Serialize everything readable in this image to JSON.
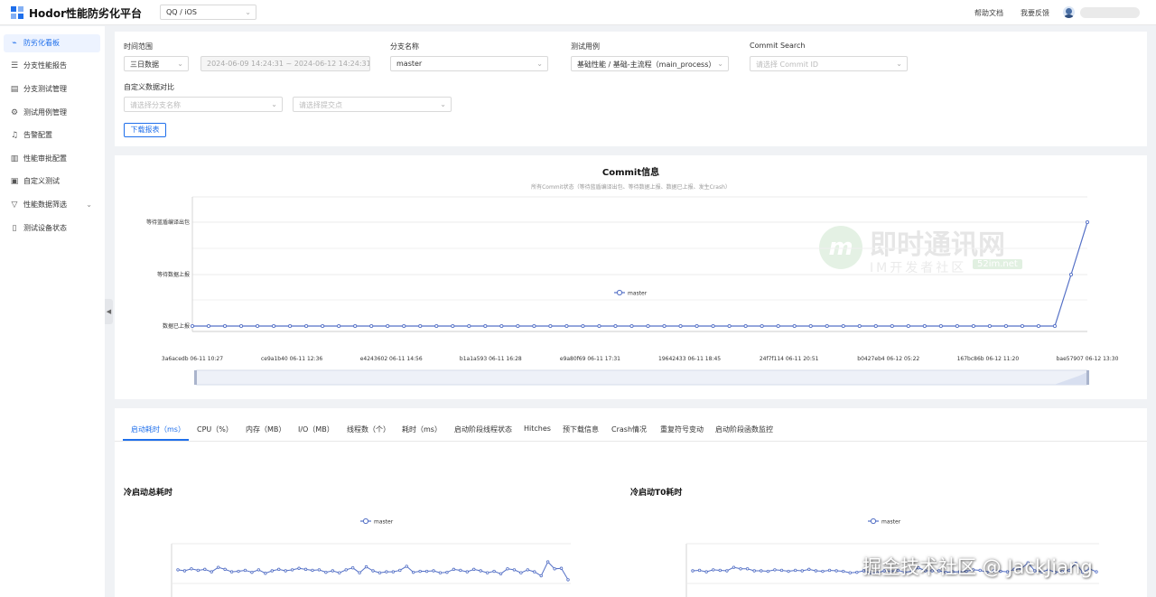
{
  "header": {
    "title": "Hodor性能防劣化平台",
    "app_selector": "QQ / iOS",
    "help_link": "帮助文档",
    "feedback_link": "我要反馈"
  },
  "sidebar": {
    "items": [
      {
        "label": "防劣化看板",
        "icon": "line-chart-icon",
        "glyph": "⌁"
      },
      {
        "label": "分支性能报告",
        "icon": "list-icon",
        "glyph": "☰"
      },
      {
        "label": "分支测试管理",
        "icon": "tasks-icon",
        "glyph": "▤"
      },
      {
        "label": "测试用例管理",
        "icon": "gear-icon",
        "glyph": "⚙"
      },
      {
        "label": "告警配置",
        "icon": "alarm-icon",
        "glyph": "♫"
      },
      {
        "label": "性能审批配置",
        "icon": "approval-icon",
        "glyph": "▥"
      },
      {
        "label": "自定义测试",
        "icon": "terminal-icon",
        "glyph": "▣"
      },
      {
        "label": "性能数据筛选",
        "icon": "filter-icon",
        "glyph": "▽"
      },
      {
        "label": "测试设备状态",
        "icon": "device-icon",
        "glyph": "▯"
      }
    ]
  },
  "filters": {
    "time_range_label": "时间范围",
    "time_range_value": "三日数据",
    "date_range": "2024-06-09 14:24:31 ~ 2024-06-12 14:24:31",
    "branch_label": "分支名称",
    "branch_value": "master",
    "case_label": "测试用例",
    "case_value": "基础性能 / 基础-主流程（main_process）",
    "commit_search_label": "Commit Search",
    "commit_search_placeholder": "请选择 Commit ID",
    "custom_compare_label": "自定义数据对比",
    "custom_branch_placeholder": "请选择分支名称",
    "custom_commit_placeholder": "请选择提交点",
    "download_button": "下载报表"
  },
  "commit_chart": {
    "title": "Commit信息",
    "subtitle": "所有Commit状态（等待蓝盾编译出包、等待数据上报、数据已上报、发生Crash）",
    "legend": "master",
    "watermark_title": "即时通讯网",
    "watermark_sub": "IM开发者社区",
    "watermark_domain": "52im.net"
  },
  "tabs": {
    "items": [
      "启动耗时（ms）",
      "CPU（%）",
      "内存（MB）",
      "I/O（MB）",
      "线程数（个）",
      "耗时（ms）",
      "启动阶段线程状态",
      "Hitches",
      "预下载信息",
      "Crash情况",
      "重复符号变动",
      "启动阶段函数监控"
    ],
    "active": 0
  },
  "small_charts": {
    "left_title": "冷启动总耗时",
    "right_title": "冷启动T0耗时",
    "legend": "master"
  },
  "footer_watermark": "掘金技术社区 @ JackJiang",
  "colors": {
    "accent": "#1f6feb",
    "series": "#5470c6"
  },
  "chart_data": [
    {
      "type": "line",
      "title": "Commit信息",
      "subtitle": "所有Commit状态（等待蓝盾编译出包、等待数据上报、数据已上报、发生Crash）",
      "y_categories": [
        "数据已上报",
        "等待数据上报",
        "等待蓝盾编译出包"
      ],
      "x_tick_labels": [
        "3a6acedb 06-11 10:27",
        "ce9a1b40 06-11 12:36",
        "e4243602 06-11 14:56",
        "b1a1a593 06-11 16:28",
        "e9a80f69 06-11 17:31",
        "19642433 06-11 18:45",
        "24f7f114 06-11 20:51",
        "b0427eb4 06-12 05:22",
        "167bc86b 06-12 11:20",
        "bae57907 06-12 13:30"
      ],
      "series": [
        {
          "name": "master",
          "values": [
            0,
            0,
            0,
            0,
            0,
            0,
            0,
            0,
            0,
            0,
            0,
            0,
            0,
            0,
            0,
            0,
            0,
            0,
            0,
            0,
            0,
            0,
            0,
            0,
            0,
            0,
            0,
            0,
            0,
            0,
            0,
            0,
            0,
            0,
            0,
            0,
            0,
            0,
            0,
            0,
            0,
            0,
            0,
            0,
            0,
            0,
            0,
            0,
            0,
            0,
            0,
            0,
            0,
            0,
            1,
            2
          ]
        }
      ]
    },
    {
      "type": "line",
      "title": "冷启动总耗时",
      "series": [
        {
          "name": "master",
          "values": [
            62,
            60,
            64,
            61,
            63,
            58,
            67,
            63,
            58,
            59,
            61,
            57,
            62,
            55,
            60,
            63,
            60,
            62,
            65,
            63,
            61,
            62,
            57,
            60,
            56,
            62,
            66,
            56,
            68,
            60,
            56,
            58,
            58,
            61,
            69,
            57,
            59,
            59,
            60,
            56,
            57,
            63,
            61,
            58,
            63,
            60,
            56,
            59,
            54,
            64,
            62,
            56,
            62,
            58,
            50,
            78,
            64,
            65,
            42
          ]
        }
      ]
    },
    {
      "type": "line",
      "title": "冷启动T0耗时",
      "series": [
        {
          "name": "master",
          "values": [
            60,
            61,
            58,
            62,
            61,
            60,
            67,
            64,
            64,
            60,
            60,
            59,
            62,
            61,
            59,
            61,
            60,
            63,
            60,
            59,
            61,
            60,
            59,
            56,
            57,
            60,
            56,
            56,
            60,
            59,
            61,
            57,
            59,
            66,
            60,
            60,
            60,
            57,
            58,
            58,
            59,
            62,
            61,
            57,
            60,
            59,
            58,
            63,
            64,
            76,
            60,
            58,
            62,
            57,
            59,
            61,
            75,
            57,
            64,
            58
          ]
        }
      ]
    }
  ]
}
